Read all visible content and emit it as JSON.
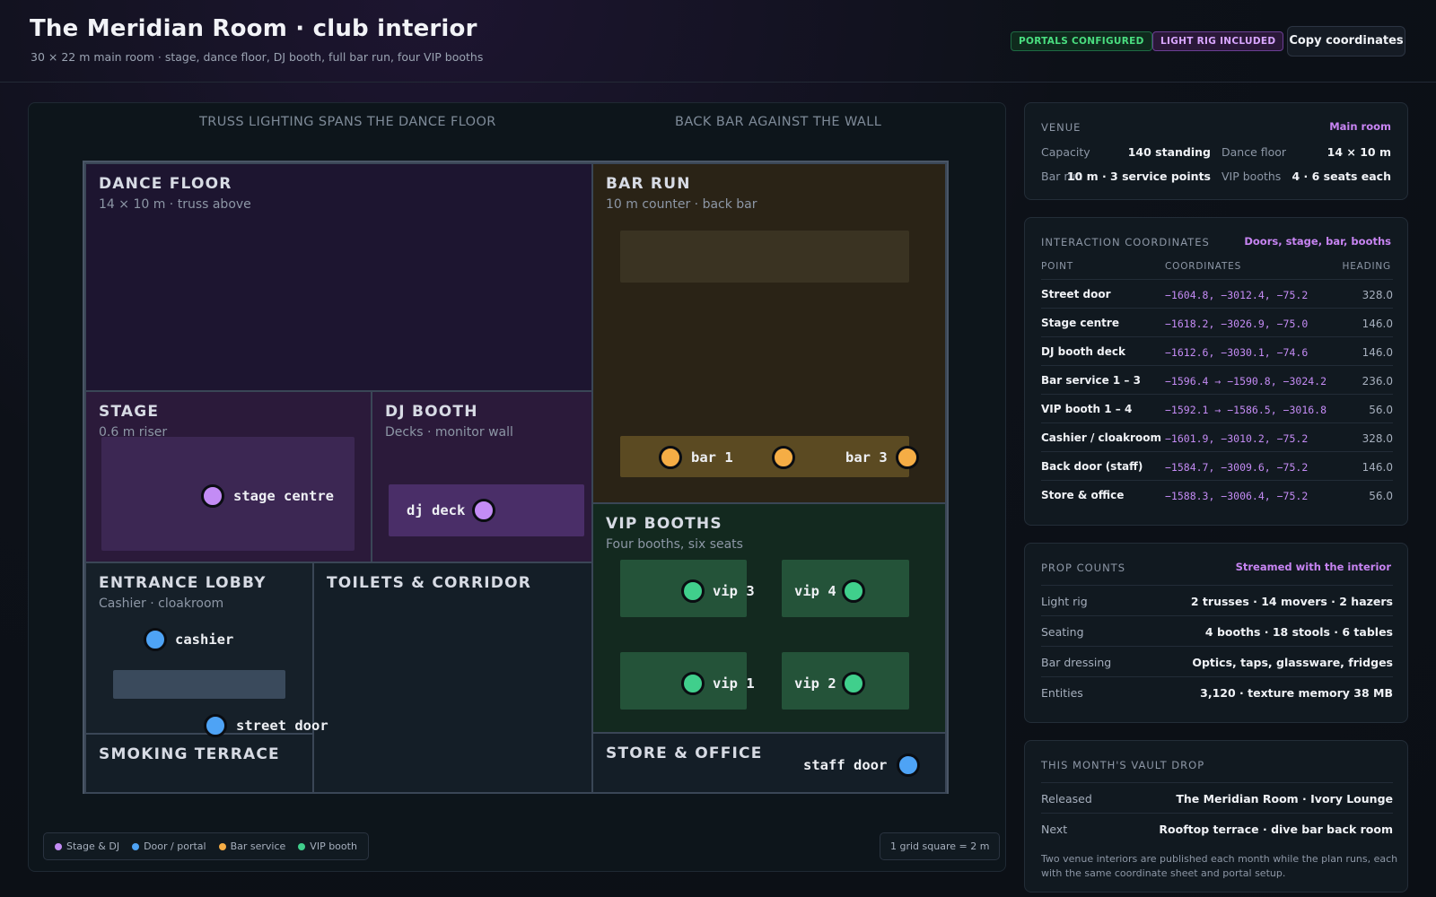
{
  "header": {
    "title": "The Meridian Room · club interior",
    "subtitle": "30 × 22 m main room · stage, dance floor, DJ booth, full bar run, four VIP booths",
    "badges": [
      "PORTALS CONFIGURED",
      "LIGHT RIG INCLUDED"
    ],
    "copy_button": "Copy coordinates"
  },
  "map": {
    "captions": [
      "TRUSS LIGHTING SPANS THE DANCE FLOOR",
      "BACK BAR AGAINST THE WALL"
    ],
    "rooms": {
      "dance_floor": {
        "name": "DANCE FLOOR",
        "sub": "14 × 10 m · truss above"
      },
      "bar_run": {
        "name": "BAR RUN",
        "sub": "10 m counter · back bar"
      },
      "stage": {
        "name": "STAGE",
        "sub": "0.6 m riser"
      },
      "dj_booth": {
        "name": "DJ BOOTH",
        "sub": "Decks · monitor wall"
      },
      "vip_booths": {
        "name": "VIP BOOTHS",
        "sub": "Four booths, six seats"
      },
      "entrance_lobby": {
        "name": "ENTRANCE LOBBY",
        "sub": "Cashier · cloakroom"
      },
      "toilets": {
        "name": "TOILETS & CORRIDOR"
      },
      "smoking_terrace": {
        "name": "SMOKING TERRACE"
      },
      "store_office": {
        "name": "STORE & OFFICE"
      }
    },
    "points": {
      "stage_centre": "stage centre",
      "dj_deck": "dj deck",
      "bar_1": "bar 1",
      "bar_3": "bar 3",
      "vip_1": "vip 1",
      "vip_2": "vip 2",
      "vip_3": "vip 3",
      "vip_4": "vip 4",
      "cashier": "cashier",
      "street_door": "street door",
      "staff_door": "staff door"
    },
    "legend": [
      {
        "label": "Stage & DJ",
        "color": "#c38cf5"
      },
      {
        "label": "Door / portal",
        "color": "#4ea3f5"
      },
      {
        "label": "Bar service",
        "color": "#f5ad45"
      },
      {
        "label": "VIP booth",
        "color": "#40cf8c"
      }
    ],
    "scale": "1 grid square = 2 m"
  },
  "venue": {
    "title": "VENUE",
    "tag": "Main room",
    "capacity_label": "Capacity",
    "capacity": "140 standing",
    "dance_label": "Dance floor",
    "dance": "14 × 10 m",
    "bar_label": "Bar run",
    "bar": "10 m · 3 service points",
    "vip_label": "VIP booths",
    "vip": "4 · 6 seats each"
  },
  "coords": {
    "title": "INTERACTION COORDINATES",
    "tag": "Doors, stage, bar, booths",
    "columns": [
      "POINT",
      "COORDINATES",
      "HEADING"
    ],
    "rows": [
      {
        "point": "Street door",
        "coords": "−1604.8, −3012.4, −75.2",
        "heading": "328.0"
      },
      {
        "point": "Stage centre",
        "coords": "−1618.2, −3026.9, −75.0",
        "heading": "146.0"
      },
      {
        "point": "DJ booth deck",
        "coords": "−1612.6, −3030.1, −74.6",
        "heading": "146.0"
      },
      {
        "point": "Bar service 1 – 3",
        "coords": "−1596.4 → −1590.8, −3024.2",
        "heading": "236.0"
      },
      {
        "point": "VIP booth 1 – 4",
        "coords": "−1592.1 → −1586.5, −3016.8",
        "heading": "56.0"
      },
      {
        "point": "Cashier / cloakroom",
        "coords": "−1601.9, −3010.2, −75.2",
        "heading": "328.0"
      },
      {
        "point": "Back door (staff)",
        "coords": "−1584.7, −3009.6, −75.2",
        "heading": "146.0"
      },
      {
        "point": "Store & office",
        "coords": "−1588.3, −3006.4, −75.2",
        "heading": "56.0"
      }
    ]
  },
  "props": {
    "title": "PROP COUNTS",
    "tag": "Streamed with the interior",
    "rows": [
      {
        "k": "Light rig",
        "v": "2 trusses · 14 movers · 2 hazers"
      },
      {
        "k": "Seating",
        "v": "4 booths · 18 stools · 6 tables"
      },
      {
        "k": "Bar dressing",
        "v": "Optics, taps, glassware, fridges"
      },
      {
        "k": "Entities",
        "v": "3,120 · texture memory 38 MB"
      }
    ]
  },
  "vault": {
    "title": "THIS MONTH'S VAULT DROP",
    "released_label": "Released",
    "released": "The Meridian Room · Ivory Lounge",
    "next_label": "Next",
    "next": "Rooftop terrace · dive bar back room",
    "note": "Two venue interiors are published each month while the plan runs, each with the same coordinate sheet and portal setup."
  }
}
